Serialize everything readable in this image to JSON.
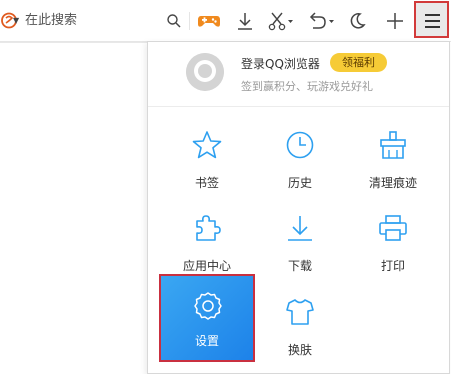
{
  "toolbar": {
    "search_placeholder": "在此搜索",
    "icons": [
      "search-engine-logo-icon",
      "chevron-down-icon",
      "search-icon",
      "game-controller-icon",
      "download-icon",
      "scissors-icon",
      "undo-icon",
      "moon-icon",
      "plus-icon",
      "hamburger-menu-icon"
    ]
  },
  "menu": {
    "user": {
      "login_label": "登录QQ浏览器",
      "welfare_badge": "领福利",
      "subtitle": "签到赢积分、玩游戏兑好礼"
    },
    "items": [
      {
        "label": "书签",
        "icon": "star-icon"
      },
      {
        "label": "历史",
        "icon": "clock-icon"
      },
      {
        "label": "清理痕迹",
        "icon": "broom-icon"
      },
      {
        "label": "应用中心",
        "icon": "puzzle-icon"
      },
      {
        "label": "下载",
        "icon": "download-icon"
      },
      {
        "label": "打印",
        "icon": "printer-icon"
      },
      {
        "label": "设置",
        "icon": "gear-icon"
      },
      {
        "label": "换肤",
        "icon": "tshirt-icon"
      }
    ]
  },
  "colors": {
    "accent": "#2ea0f0",
    "highlight_border": "#d23a3a",
    "badge": "#f6cb36",
    "settings_tile": "#1d82e9"
  }
}
